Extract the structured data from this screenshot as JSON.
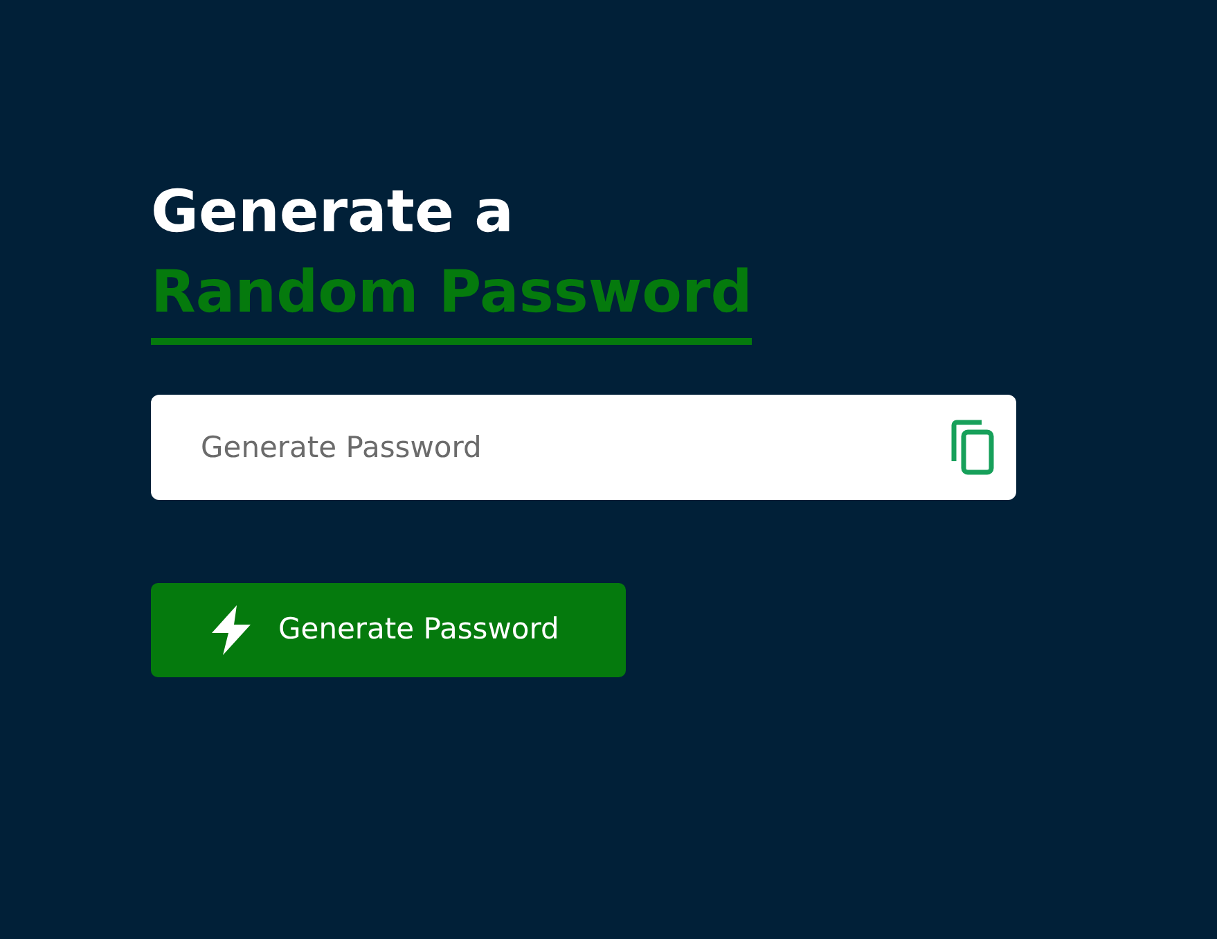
{
  "heading": {
    "line_1": "Generate a",
    "line_2": "Random Password"
  },
  "password_field": {
    "placeholder": "Generate Password"
  },
  "generate_button": {
    "label": "Generate Password"
  }
}
